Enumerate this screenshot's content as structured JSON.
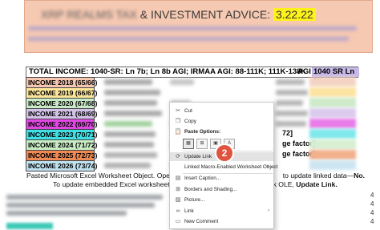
{
  "header": {
    "title_prefix": "& INVESTMENT ADVICE:",
    "date": "3.22.22",
    "colors": {
      "background": "#f6c9b2",
      "date_highlight": "#fff21b"
    }
  },
  "table": {
    "total_label": "TOTAL INCOME: 1040-SR: Ln 7b; Ln 8b AGI; IRMAA AGI: 88-111K; 111K-138K",
    "agi_label": "AGI",
    "sr_label": "1040 SR Ln 8b",
    "rows": [
      {
        "label": "INCOME 2018 (65/66)",
        "color": "#f6c7b0"
      },
      {
        "label": "INCOME 2019 (66/67)",
        "color": "#fde69a"
      },
      {
        "label": "INCOME 2020 (67/68)",
        "color": "#c8eac6"
      },
      {
        "label": "INCOME 2021 (68/69)",
        "color": "#d4c3e9"
      },
      {
        "label": "INCOME 2022 (69/70)",
        "color": "#e048e3"
      },
      {
        "label": "INCOME 2023 (70/71)",
        "color": "#3ee0e6"
      },
      {
        "label": "INCOME 2024 (71/72)",
        "color": "#c9ecc4"
      },
      {
        "label": "INCOME 2025 (72/73)",
        "color": "#f08a54"
      },
      {
        "label": "INCOME 2026 (73/74)",
        "color": "#bfe0ee"
      }
    ],
    "bracket_texts": [
      "72]",
      "ge factor]",
      "ge factor]"
    ]
  },
  "caption": {
    "line1_a": "Pasted Microsoft Excel Worksheet Object. Open ",
    "line1_em": "expe",
    "line1_b": "to update linked data—",
    "line1_no": "No.",
    "line2_a": "To update embedded Excel worksheet obj",
    "line2_b": "k OLE, ",
    "line2_bold": "Update Link."
  },
  "page_numbers": [
    "4",
    "4",
    "4",
    "4"
  ],
  "context_menu": {
    "items": {
      "cut": "Cut",
      "copy": "Copy",
      "paste_options": "Paste Options:",
      "update_link": "Update Link",
      "linked_object": "Linked Macro-Enabled Worksheet Object",
      "insert_caption": "Insert Caption...",
      "borders": "Borders and Shading...",
      "picture": "Picture...",
      "link": "Link",
      "new_comment": "New Comment"
    },
    "step_badge": "2"
  }
}
